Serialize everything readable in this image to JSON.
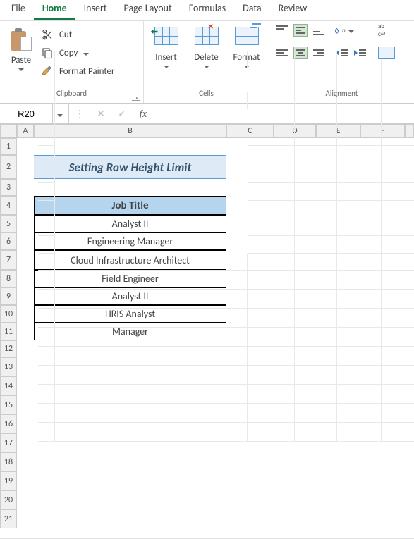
{
  "tabs": [
    "File",
    "Home",
    "Insert",
    "Page Layout",
    "Formulas",
    "Data",
    "Review"
  ],
  "active_tab": 1,
  "clipboard": {
    "paste": "Paste",
    "cut": "Cut",
    "copy": "Copy",
    "painter": "Format Painter",
    "group": "Clipboard"
  },
  "cells": {
    "insert": "Insert",
    "delete": "Delete",
    "format": "Format",
    "group": "Cells"
  },
  "alignment": {
    "group": "Alignment"
  },
  "namebox": "R20",
  "formula": "",
  "columns": [
    "A",
    "B",
    "C",
    "D",
    "E",
    "F"
  ],
  "rows": [
    "1",
    "2",
    "3",
    "4",
    "5",
    "6",
    "7",
    "8",
    "9",
    "10",
    "11",
    "12",
    "13",
    "14",
    "15",
    "16",
    "17",
    "18",
    "19",
    "20",
    "21"
  ],
  "sheet_title": "Setting Row Height Limit",
  "table_header": "Job Title",
  "table_rows": [
    "Analyst II",
    "Engineering Manager",
    "Cloud Infrastructure Architect",
    "Field Engineer",
    "Analyst II",
    "HRIS Analyst",
    "Manager"
  ]
}
